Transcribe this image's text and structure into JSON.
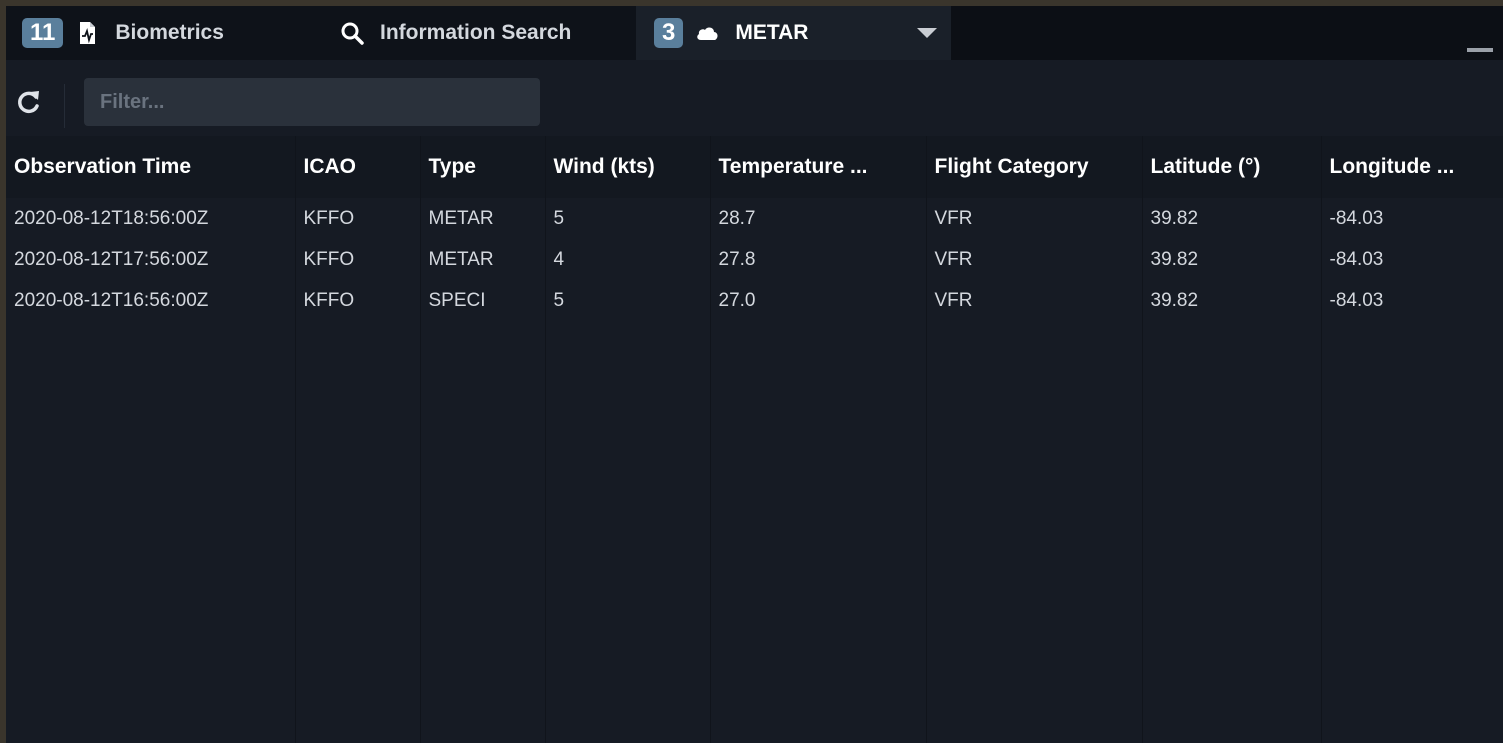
{
  "tabs": [
    {
      "badge": "11",
      "icon": "file-chart-icon",
      "label": "Biometrics"
    },
    {
      "badge": "",
      "icon": "search-icon",
      "label": "Information Search"
    },
    {
      "badge": "3",
      "icon": "cloud-icon",
      "label": "METAR"
    }
  ],
  "toolbar": {
    "refresh_icon": "refresh-icon",
    "filter_placeholder": "Filter...",
    "filter_value": ""
  },
  "table": {
    "columns": [
      "Observation Time",
      "ICAO",
      "Type",
      "Wind (kts)",
      "Temperature ...",
      "Flight Category",
      "Latitude (°)",
      "Longitude ..."
    ],
    "rows": [
      [
        "2020-08-12T18:56:00Z",
        "KFFO",
        "METAR",
        "5",
        "28.7",
        "VFR",
        "39.82",
        "-84.03"
      ],
      [
        "2020-08-12T17:56:00Z",
        "KFFO",
        "METAR",
        "4",
        "27.8",
        "VFR",
        "39.82",
        "-84.03"
      ],
      [
        "2020-08-12T16:56:00Z",
        "KFFO",
        "SPECI",
        "5",
        "27.0",
        "VFR",
        "39.82",
        "-84.03"
      ]
    ]
  },
  "colors": {
    "badge": "#5a7f9c",
    "background": "#161b24",
    "tabbar": "#0c0f15"
  }
}
